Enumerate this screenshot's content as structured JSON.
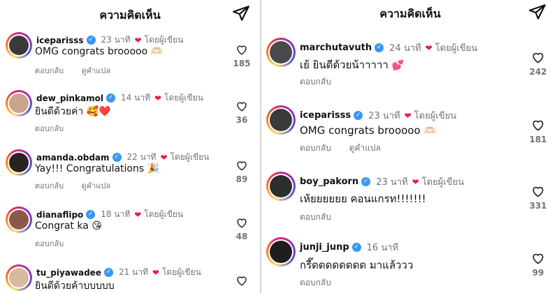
{
  "left_panel": {
    "title": "ความคิดเห็น",
    "comments": [
      {
        "username": "iceparisss",
        "verified": true,
        "time": "23 นาที",
        "author_label": "โดยผู้เขียน",
        "text": "OMG congrats brooooo",
        "emoji": "🫶🏻",
        "reply": "ตอบกลับ",
        "translate": "ดูคำแปล",
        "likes": "185"
      },
      {
        "username": "dew_pinkamol",
        "verified": true,
        "time": "14 นาที",
        "author_label": "โดยผู้เขียน",
        "text": "ยินดีด้วยค่า",
        "emoji": "🥰❤️",
        "reply": "ตอบกลับ",
        "translate": "",
        "likes": "36"
      },
      {
        "username": "amanda.obdam",
        "verified": true,
        "time": "22 นาที",
        "author_label": "โดยผู้เขียน",
        "text": "Yay!!! Congratulations",
        "emoji": "🎉",
        "reply": "ตอบกลับ",
        "translate": "ดูคำแปล",
        "likes": "89"
      },
      {
        "username": "dianaflipo",
        "verified": true,
        "time": "18 นาที",
        "author_label": "โดยผู้เขียน",
        "text": "Congrat ka",
        "emoji": "😘",
        "reply": "ตอบกลับ",
        "translate": "",
        "likes": "48"
      },
      {
        "username": "tu_piyawadee",
        "verified": true,
        "time": "21 นาที",
        "author_label": "โดยผู้เขียน",
        "text": "ยินดีด้วยค้าบบบบบ",
        "emoji": "",
        "reply": "",
        "translate": "",
        "likes": ""
      }
    ]
  },
  "right_panel": {
    "title": "ความคิดเห็น",
    "comments": [
      {
        "username": "marchutavuth",
        "verified": true,
        "time": "24 นาที",
        "author_label": "โดยผู้เขียน",
        "text": "เย้ ยินดีด้วยน้าาาาา",
        "emoji": "💕",
        "reply": "ตอบกลับ",
        "translate": "",
        "likes": "242"
      },
      {
        "username": "iceparisss",
        "verified": true,
        "time": "23 นาที",
        "author_label": "โดยผู้เขียน",
        "text": "OMG congrats brooooo",
        "emoji": "🫶🏻",
        "reply": "ตอบกลับ",
        "translate": "ดูคำแปล",
        "likes": "181"
      },
      {
        "username": "boy_pakorn",
        "verified": true,
        "time": "23 นาที",
        "author_label": "โดยผู้เขียน",
        "text": "เห้ยยยยยย คอนแกรท!!!!!!!",
        "emoji": "",
        "reply": "ตอบกลับ",
        "translate": "",
        "likes": "331"
      },
      {
        "username": "junji_junp",
        "verified": true,
        "time": "16 นาที",
        "author_label": "",
        "text": "กรี๊ดดดดดดดด มาแล้ววว",
        "emoji": "",
        "reply": "ตอบกลับ",
        "translate": "",
        "likes": "99"
      }
    ]
  }
}
